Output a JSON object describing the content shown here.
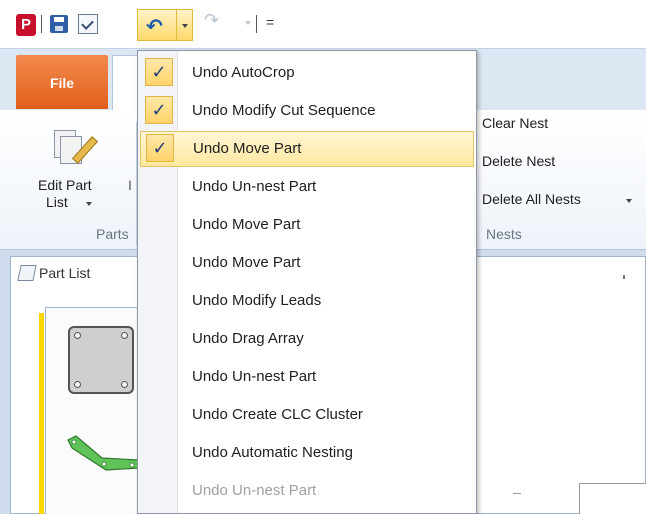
{
  "qat": {
    "logo": "P",
    "custom_glyph": "="
  },
  "tabs": {
    "file": "File"
  },
  "ribbon": {
    "edit_part_list_line1": "Edit Part",
    "edit_part_list_line2": "List",
    "parts_group": "Parts",
    "clear_nest": "Clear Nest",
    "delete_nest": "Delete Nest",
    "delete_all_nests": "Delete All Nests",
    "nests_group": "Nests"
  },
  "part_list": {
    "title": "Part List"
  },
  "undo_menu": {
    "items": [
      {
        "label": "Undo AutoCrop",
        "checked": true,
        "highlight": false,
        "faded": false
      },
      {
        "label": "Undo Modify Cut Sequence",
        "checked": true,
        "highlight": false,
        "faded": false
      },
      {
        "label": "Undo Move Part",
        "checked": true,
        "highlight": true,
        "faded": false
      },
      {
        "label": "Undo Un-nest Part",
        "checked": false,
        "highlight": false,
        "faded": false
      },
      {
        "label": "Undo Move Part",
        "checked": false,
        "highlight": false,
        "faded": false
      },
      {
        "label": "Undo Move Part",
        "checked": false,
        "highlight": false,
        "faded": false
      },
      {
        "label": "Undo Modify Leads",
        "checked": false,
        "highlight": false,
        "faded": false
      },
      {
        "label": "Undo Drag Array",
        "checked": false,
        "highlight": false,
        "faded": false
      },
      {
        "label": "Undo Un-nest Part",
        "checked": false,
        "highlight": false,
        "faded": false
      },
      {
        "label": "Undo Create CLC Cluster",
        "checked": false,
        "highlight": false,
        "faded": false
      },
      {
        "label": "Undo Automatic Nesting",
        "checked": false,
        "highlight": false,
        "faded": false
      },
      {
        "label": "Undo Un-nest Part",
        "checked": false,
        "highlight": false,
        "faded": true
      }
    ],
    "check_glyph": "✓"
  },
  "colors": {
    "file_tab": "#e25e1c",
    "menu_highlight": "#ffe8a0",
    "check_bg": "#ffd36b",
    "part_list_bar": "#ffd400",
    "part_green": "#5fc35a"
  },
  "icons": {
    "undo": "undo-arrow-icon",
    "redo": "redo-arrow-icon",
    "save": "save-icon",
    "check": "checkmark-icon"
  }
}
